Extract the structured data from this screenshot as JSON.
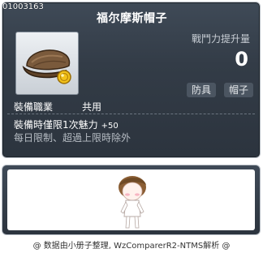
{
  "item": {
    "code": "01003163",
    "name": "福尔摩斯帽子",
    "icon": "detective-cap-icon",
    "stat_label": "戰鬥力提升量",
    "stat_value": "0",
    "tags": [
      "防具",
      "帽子"
    ],
    "job_label": "裝備職業",
    "job_value": "共用",
    "desc_line1": "裝備時僅限1次魅力",
    "desc_line1_plus": "+50",
    "desc_line2": "每日限制、超過上限時除外"
  },
  "preview": {
    "avatar": "character-avatar-icon"
  },
  "footer": {
    "credit": "@ 数据由小册子整理, WzComparerR2-NTMS解析 @"
  },
  "colors": {
    "panel": "#333c47",
    "border": "#b8bec6",
    "text": "#ffffff",
    "muted": "#b7bdc4"
  }
}
